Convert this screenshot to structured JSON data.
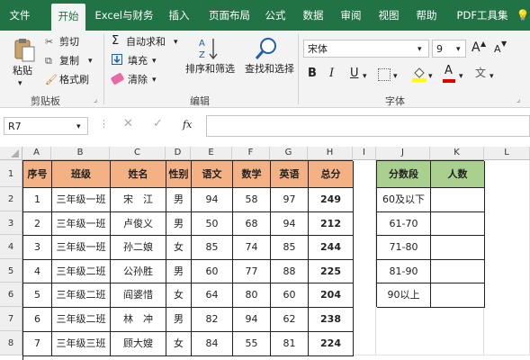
{
  "menu": {
    "tabs": [
      "文件",
      "开始",
      "Excel与财务",
      "插入",
      "页面布局",
      "公式",
      "数据",
      "审阅",
      "视图",
      "帮助",
      "PDF工具集"
    ]
  },
  "ribbon": {
    "clipboard": {
      "paste": "粘贴",
      "cut": "剪切",
      "copy": "复制",
      "format_painter": "格式刷",
      "group": "剪贴板"
    },
    "editing": {
      "autosum": "自动求和",
      "fill": "填充",
      "clear": "清除",
      "sort_filter": "排序和筛选",
      "find_select": "查找和选择",
      "group": "编辑"
    },
    "font": {
      "name": "宋体",
      "size": "9",
      "bold": "B",
      "italic": "I",
      "underline": "U",
      "grow": "A",
      "shrink": "A",
      "color_a": "A",
      "group": "字体"
    }
  },
  "formula_bar": {
    "name_box": "R7",
    "fx": "fx",
    "formula": ""
  },
  "columns": [
    "A",
    "B",
    "C",
    "D",
    "E",
    "F",
    "G",
    "H",
    "I",
    "J",
    "K",
    "L"
  ],
  "rows": [
    "1",
    "2",
    "3",
    "4",
    "5",
    "6",
    "7",
    "8"
  ],
  "table": {
    "headers": [
      "序号",
      "班级",
      "姓名",
      "性别",
      "语文",
      "数学",
      "英语",
      "总分"
    ],
    "data": [
      [
        "1",
        "三年级一班",
        "宋　江",
        "男",
        "94",
        "58",
        "97",
        "249"
      ],
      [
        "2",
        "三年级一班",
        "卢俊义",
        "男",
        "50",
        "68",
        "94",
        "212"
      ],
      [
        "3",
        "三年级一班",
        "孙二娘",
        "女",
        "85",
        "74",
        "85",
        "244"
      ],
      [
        "4",
        "三年级二班",
        "公孙胜",
        "男",
        "60",
        "77",
        "88",
        "225"
      ],
      [
        "5",
        "三年级二班",
        "阎婆惜",
        "女",
        "64",
        "80",
        "60",
        "204"
      ],
      [
        "6",
        "三年级二班",
        "林　冲",
        "男",
        "82",
        "94",
        "62",
        "238"
      ],
      [
        "7",
        "三年级三班",
        "顾大嫂",
        "女",
        "84",
        "55",
        "81",
        "224"
      ]
    ]
  },
  "score_table": {
    "headers": [
      "分数段",
      "人数"
    ],
    "ranges": [
      "60及以下",
      "61-70",
      "71-80",
      "81-90",
      "90以上"
    ]
  }
}
